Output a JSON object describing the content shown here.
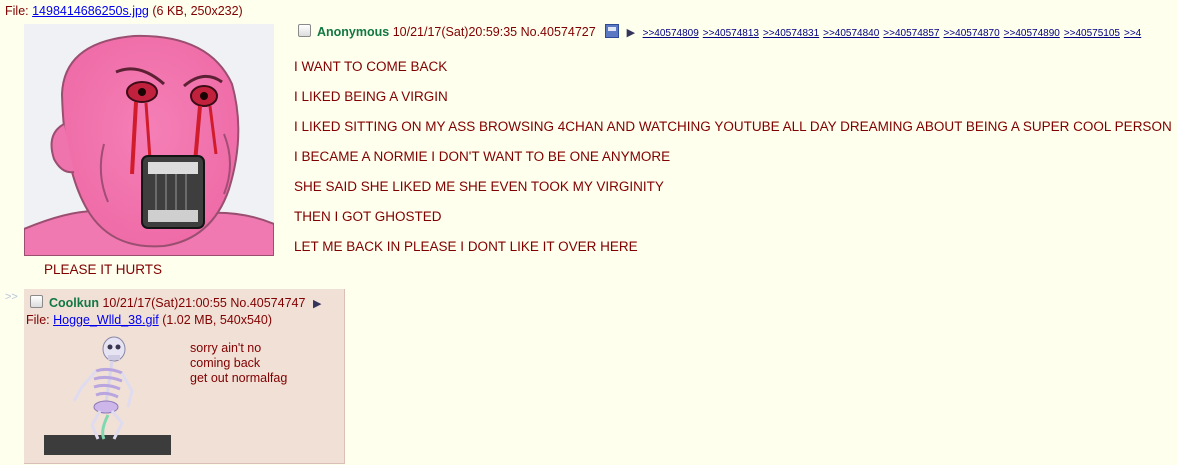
{
  "op": {
    "file_label": "File:",
    "file_name": "1498414686250s.jpg",
    "file_meta": "(6 KB, 250x232)",
    "name": "Anonymous",
    "datetime": "10/21/17(Sat)20:59:35",
    "post_no": "No.40574727",
    "backlinks": [
      ">>40574809",
      ">>40574813",
      ">>40574831",
      ">>40574840",
      ">>40574857",
      ">>40574870",
      ">>40574890",
      ">>40575105",
      ">>4"
    ],
    "body_lines": [
      "I WANT TO COME BACK",
      "I LIKED BEING A VIRGIN",
      "I LIKED SITTING ON MY ASS BROWSING 4CHAN AND WATCHING YOUTUBE ALL DAY DREAMING ABOUT BEING A SUPER COOL PERSON",
      "I BECAME A NORMIE I DON'T WANT TO BE ONE ANYMORE",
      "SHE SAID SHE LIKED ME SHE EVEN TOOK MY VIRGINITY",
      "THEN I GOT GHOSTED",
      "LET ME BACK IN PLEASE I DONT LIKE IT OVER HERE"
    ],
    "under_text": "PLEASE IT HURTS"
  },
  "reply": {
    "side_arrows": ">>",
    "name": "Coolkun",
    "datetime": "10/21/17(Sat)21:00:55",
    "post_no": "No.40574747",
    "file_label": "File:",
    "file_name": "Hogge_Wlld_38.gif",
    "file_meta": "(1.02 MB, 540x540)",
    "body_lines": [
      "sorry ain't no",
      "coming back",
      "get out normalfag"
    ]
  },
  "icons": {
    "checkbox": "checkbox-icon",
    "menu": "triangle-right-icon",
    "save": "floppy-disk-icon"
  },
  "colors": {
    "page_bg": "#FFFFEE",
    "text": "#800000",
    "name": "#117743",
    "reply_bg": "#F0E0D6",
    "link": "#0000EE"
  }
}
